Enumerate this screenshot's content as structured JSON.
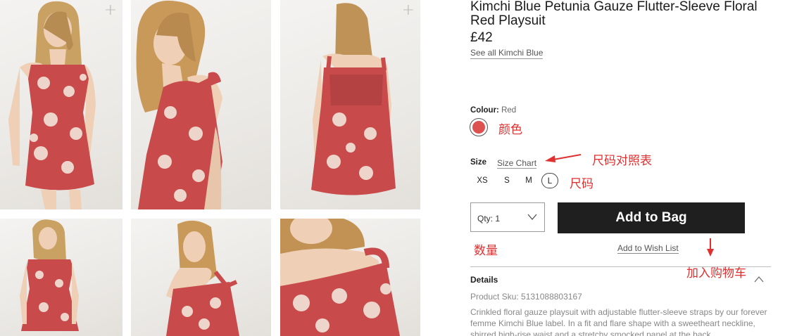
{
  "gallery": {
    "images": [
      {
        "alt": "Model front view, full length",
        "plus": "+"
      },
      {
        "alt": "Model side view, looking over shoulder",
        "plus": ""
      },
      {
        "alt": "Model back view",
        "plus": "+"
      },
      {
        "alt": "Model front view, cropped",
        "plus": ""
      },
      {
        "alt": "Model three-quarter back view",
        "plus": ""
      },
      {
        "alt": "Neckline detail",
        "plus": ""
      }
    ]
  },
  "product": {
    "title": "Kimchi Blue Petunia Gauze Flutter-Sleeve Floral Red Playsuit",
    "price": "£42",
    "see_all": "See all Kimchi Blue",
    "colour_label": "Colour:",
    "colour_value": "Red",
    "swatch_color": "#dd5151",
    "size_label": "Size",
    "size_chart": "Size Chart",
    "sizes": [
      "XS",
      "S",
      "M",
      "L"
    ],
    "selected_size": "L",
    "qty_label": "Qty: 1",
    "add_to_bag": "Add to Bag",
    "wish_list": "Add to Wish List",
    "details_heading": "Details",
    "sku": "Product Sku: 5131088803167",
    "description": "Crinkled floral gauze playsuit with adjustable flutter-sleeve straps by our forever femme Kimchi Blue label. In a fit and flare shape with a sweetheart neckline, shirred high-rise waist and a stretchy smocked panel at the back"
  },
  "annotations": {
    "colour": "颜色",
    "size_chart": "尺码对照表",
    "size": "尺码",
    "quantity": "数量",
    "add_to_cart": "加入购物车",
    "accent_color": "#e03030"
  }
}
